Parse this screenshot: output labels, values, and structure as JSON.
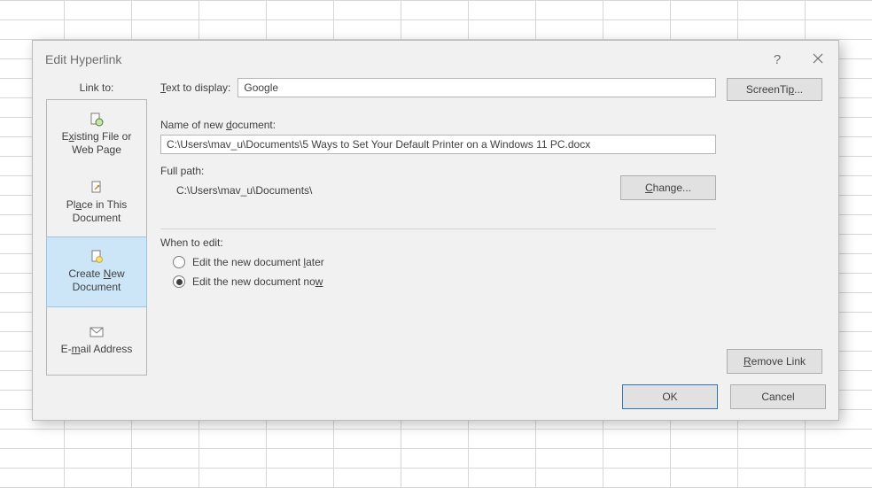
{
  "dialog": {
    "title": "Edit Hyperlink",
    "help_tooltip": "?",
    "close_tooltip": "Close"
  },
  "linkto": {
    "label": "Link to:",
    "items": [
      {
        "label_pre": "E",
        "label_u": "x",
        "label_post": "isting File or\nWeb Page"
      },
      {
        "label_pre": "Pl",
        "label_u": "a",
        "label_post": "ce in This\nDocument"
      },
      {
        "label_pre": "Create ",
        "label_u": "N",
        "label_post": "ew\nDocument"
      },
      {
        "label_pre": "E-",
        "label_u": "m",
        "label_post": "ail Address"
      }
    ]
  },
  "form": {
    "text_to_display_label_pre": "",
    "text_to_display_label_u": "T",
    "text_to_display_label_post": "ext to display:",
    "text_to_display_value": "Google",
    "screen_tip_pre": "ScreenTi",
    "screen_tip_u": "p",
    "screen_tip_post": "...",
    "name_new_doc_label_pre": "Name of new ",
    "name_new_doc_label_u": "d",
    "name_new_doc_label_post": "ocument:",
    "name_new_doc_value": "C:\\Users\\mav_u\\Documents\\5 Ways to Set Your Default Printer on a Windows 11 PC.docx",
    "full_path_label": "Full path:",
    "full_path_value": "C:\\Users\\mav_u\\Documents\\",
    "change_pre": "",
    "change_u": "C",
    "change_post": "hange...",
    "when_to_edit_label": "When to edit:",
    "radio_later_pre": "Edit the new document ",
    "radio_later_u": "l",
    "radio_later_post": "ater",
    "radio_now_pre": "Edit the new document no",
    "radio_now_u": "w",
    "radio_now_post": "",
    "remove_link_pre": "",
    "remove_link_u": "R",
    "remove_link_post": "emove Link",
    "ok": "OK",
    "cancel": "Cancel"
  }
}
